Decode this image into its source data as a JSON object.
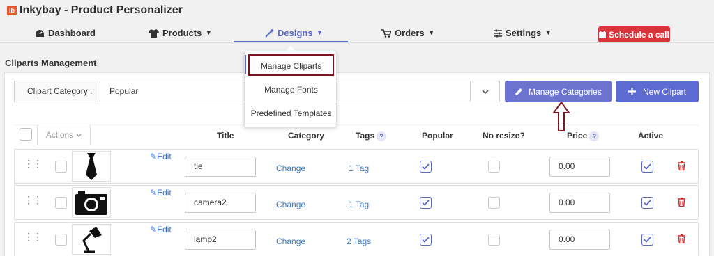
{
  "app": {
    "logo_text": "ib",
    "title": "Inkybay - Product Personalizer"
  },
  "nav": {
    "items": [
      {
        "label": "Dashboard",
        "icon": "dashboard-icon",
        "has_caret": false
      },
      {
        "label": "Products",
        "icon": "tshirt-icon",
        "has_caret": true
      },
      {
        "label": "Designs",
        "icon": "magic-wand-icon",
        "has_caret": true,
        "active": true
      },
      {
        "label": "Orders",
        "icon": "cart-icon",
        "has_caret": true
      },
      {
        "label": "Settings",
        "icon": "sliders-icon",
        "has_caret": true
      }
    ],
    "cta_label": "Schedule a call"
  },
  "section_title": "Cliparts Management",
  "dropdown": {
    "items": [
      "Manage Cliparts",
      "Manage Fonts",
      "Predefined Templates"
    ],
    "selected": "Manage Cliparts"
  },
  "category_filter": {
    "label": "Clipart Category :",
    "value": "Popular"
  },
  "buttons": {
    "manage_categories": "Manage Categories",
    "new_clipart": "New Clipart"
  },
  "table": {
    "actions_label": "Actions",
    "headers": {
      "title": "Title",
      "category": "Category",
      "tags": "Tags",
      "popular": "Popular",
      "no_resize": "No resize?",
      "price": "Price",
      "active": "Active"
    },
    "rows": [
      {
        "image": "tie",
        "edit_label": "Edit",
        "title": "tie",
        "category_action": "Change",
        "tags": "1 Tag",
        "popular": true,
        "no_resize": false,
        "price": "0.00",
        "active": true
      },
      {
        "image": "camera",
        "edit_label": "Edit",
        "title": "camera2",
        "category_action": "Change",
        "tags": "1 Tag",
        "popular": true,
        "no_resize": false,
        "price": "0.00",
        "active": true
      },
      {
        "image": "lamp",
        "edit_label": "Edit",
        "title": "lamp2",
        "category_action": "Change",
        "tags": "2 Tags",
        "popular": true,
        "no_resize": false,
        "price": "0.00",
        "active": true
      }
    ]
  },
  "colors": {
    "accent": "#5867c8",
    "button": "#6b73cf",
    "cta": "#d9343b",
    "highlight": "#7d1422",
    "delete": "#d42a2a"
  }
}
